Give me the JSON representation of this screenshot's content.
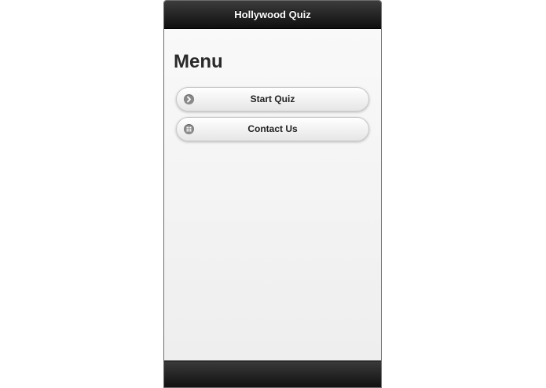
{
  "header": {
    "title": "Hollywood Quiz"
  },
  "main": {
    "heading": "Menu",
    "buttons": [
      {
        "label": "Start Quiz",
        "icon": "arrow-right-icon"
      },
      {
        "label": "Contact Us",
        "icon": "grid-icon"
      }
    ]
  },
  "colors": {
    "toolbar": "#1a1a1a",
    "background": "#f2f2f2",
    "icon": "#8a8a8a"
  }
}
